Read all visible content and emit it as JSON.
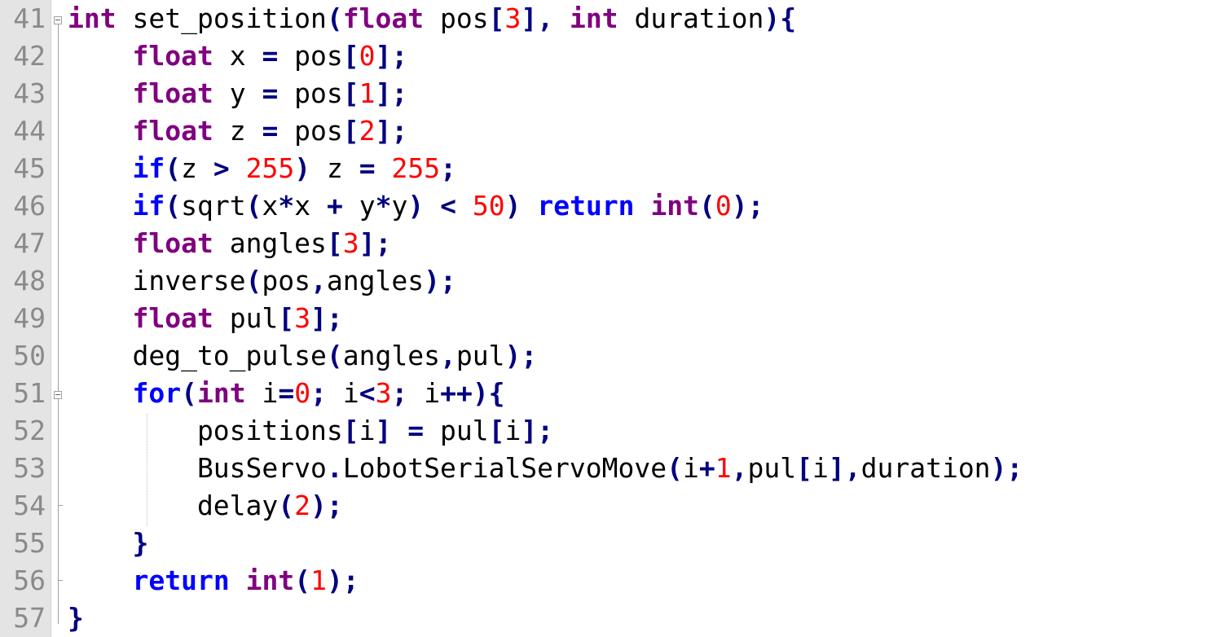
{
  "editor": {
    "lines": [
      {
        "number": "41",
        "tokens": [
          {
            "t": "int",
            "c": "kw-purple"
          },
          {
            "t": " set_position",
            "c": "ident"
          },
          {
            "t": "(",
            "c": "op"
          },
          {
            "t": "float",
            "c": "kw-purple"
          },
          {
            "t": " pos",
            "c": "ident"
          },
          {
            "t": "[",
            "c": "op"
          },
          {
            "t": "3",
            "c": "num"
          },
          {
            "t": "],",
            "c": "op"
          },
          {
            "t": " ",
            "c": "ident"
          },
          {
            "t": "int",
            "c": "kw-purple"
          },
          {
            "t": " duration",
            "c": "ident"
          },
          {
            "t": "){",
            "c": "op"
          }
        ]
      },
      {
        "number": "42",
        "tokens": [
          {
            "t": "    ",
            "c": "ident"
          },
          {
            "t": "float",
            "c": "kw-purple"
          },
          {
            "t": " x ",
            "c": "ident"
          },
          {
            "t": "=",
            "c": "op"
          },
          {
            "t": " pos",
            "c": "ident"
          },
          {
            "t": "[",
            "c": "op"
          },
          {
            "t": "0",
            "c": "num"
          },
          {
            "t": "];",
            "c": "op"
          }
        ]
      },
      {
        "number": "43",
        "tokens": [
          {
            "t": "    ",
            "c": "ident"
          },
          {
            "t": "float",
            "c": "kw-purple"
          },
          {
            "t": " y ",
            "c": "ident"
          },
          {
            "t": "=",
            "c": "op"
          },
          {
            "t": " pos",
            "c": "ident"
          },
          {
            "t": "[",
            "c": "op"
          },
          {
            "t": "1",
            "c": "num"
          },
          {
            "t": "];",
            "c": "op"
          }
        ]
      },
      {
        "number": "44",
        "tokens": [
          {
            "t": "    ",
            "c": "ident"
          },
          {
            "t": "float",
            "c": "kw-purple"
          },
          {
            "t": " z ",
            "c": "ident"
          },
          {
            "t": "=",
            "c": "op"
          },
          {
            "t": " pos",
            "c": "ident"
          },
          {
            "t": "[",
            "c": "op"
          },
          {
            "t": "2",
            "c": "num"
          },
          {
            "t": "];",
            "c": "op"
          }
        ]
      },
      {
        "number": "45",
        "tokens": [
          {
            "t": "    ",
            "c": "ident"
          },
          {
            "t": "if",
            "c": "kw-blue"
          },
          {
            "t": "(",
            "c": "op"
          },
          {
            "t": "z ",
            "c": "ident"
          },
          {
            "t": ">",
            "c": "op"
          },
          {
            "t": " ",
            "c": "ident"
          },
          {
            "t": "255",
            "c": "num"
          },
          {
            "t": ")",
            "c": "op"
          },
          {
            "t": " z ",
            "c": "ident"
          },
          {
            "t": "=",
            "c": "op"
          },
          {
            "t": " ",
            "c": "ident"
          },
          {
            "t": "255",
            "c": "num"
          },
          {
            "t": ";",
            "c": "op"
          }
        ]
      },
      {
        "number": "46",
        "tokens": [
          {
            "t": "    ",
            "c": "ident"
          },
          {
            "t": "if",
            "c": "kw-blue"
          },
          {
            "t": "(",
            "c": "op"
          },
          {
            "t": "sqrt",
            "c": "ident"
          },
          {
            "t": "(",
            "c": "op"
          },
          {
            "t": "x",
            "c": "ident"
          },
          {
            "t": "*",
            "c": "op"
          },
          {
            "t": "x ",
            "c": "ident"
          },
          {
            "t": "+",
            "c": "op"
          },
          {
            "t": " y",
            "c": "ident"
          },
          {
            "t": "*",
            "c": "op"
          },
          {
            "t": "y",
            "c": "ident"
          },
          {
            "t": ")",
            "c": "op"
          },
          {
            "t": " ",
            "c": "ident"
          },
          {
            "t": "<",
            "c": "op"
          },
          {
            "t": " ",
            "c": "ident"
          },
          {
            "t": "50",
            "c": "num"
          },
          {
            "t": ")",
            "c": "op"
          },
          {
            "t": " ",
            "c": "ident"
          },
          {
            "t": "return",
            "c": "kw-blue"
          },
          {
            "t": " ",
            "c": "ident"
          },
          {
            "t": "int",
            "c": "kw-purple"
          },
          {
            "t": "(",
            "c": "op"
          },
          {
            "t": "0",
            "c": "num"
          },
          {
            "t": ");",
            "c": "op"
          }
        ]
      },
      {
        "number": "47",
        "tokens": [
          {
            "t": "    ",
            "c": "ident"
          },
          {
            "t": "float",
            "c": "kw-purple"
          },
          {
            "t": " angles",
            "c": "ident"
          },
          {
            "t": "[",
            "c": "op"
          },
          {
            "t": "3",
            "c": "num"
          },
          {
            "t": "];",
            "c": "op"
          }
        ]
      },
      {
        "number": "48",
        "tokens": [
          {
            "t": "    inverse",
            "c": "ident"
          },
          {
            "t": "(",
            "c": "op"
          },
          {
            "t": "pos",
            "c": "ident"
          },
          {
            "t": ",",
            "c": "op"
          },
          {
            "t": "angles",
            "c": "ident"
          },
          {
            "t": ");",
            "c": "op"
          }
        ]
      },
      {
        "number": "49",
        "tokens": [
          {
            "t": "    ",
            "c": "ident"
          },
          {
            "t": "float",
            "c": "kw-purple"
          },
          {
            "t": " pul",
            "c": "ident"
          },
          {
            "t": "[",
            "c": "op"
          },
          {
            "t": "3",
            "c": "num"
          },
          {
            "t": "];",
            "c": "op"
          }
        ]
      },
      {
        "number": "50",
        "tokens": [
          {
            "t": "    deg_to_pulse",
            "c": "ident"
          },
          {
            "t": "(",
            "c": "op"
          },
          {
            "t": "angles",
            "c": "ident"
          },
          {
            "t": ",",
            "c": "op"
          },
          {
            "t": "pul",
            "c": "ident"
          },
          {
            "t": ");",
            "c": "op"
          }
        ]
      },
      {
        "number": "51",
        "tokens": [
          {
            "t": "    ",
            "c": "ident"
          },
          {
            "t": "for",
            "c": "kw-blue"
          },
          {
            "t": "(",
            "c": "op"
          },
          {
            "t": "int",
            "c": "kw-purple"
          },
          {
            "t": " i",
            "c": "ident"
          },
          {
            "t": "=",
            "c": "op"
          },
          {
            "t": "0",
            "c": "num"
          },
          {
            "t": ";",
            "c": "op"
          },
          {
            "t": " i",
            "c": "ident"
          },
          {
            "t": "<",
            "c": "op"
          },
          {
            "t": "3",
            "c": "num"
          },
          {
            "t": ";",
            "c": "op"
          },
          {
            "t": " i",
            "c": "ident"
          },
          {
            "t": "++){",
            "c": "op"
          }
        ]
      },
      {
        "number": "52",
        "tokens": [
          {
            "t": "        positions",
            "c": "ident"
          },
          {
            "t": "[",
            "c": "op"
          },
          {
            "t": "i",
            "c": "ident"
          },
          {
            "t": "]",
            "c": "op"
          },
          {
            "t": " ",
            "c": "ident"
          },
          {
            "t": "=",
            "c": "op"
          },
          {
            "t": " pul",
            "c": "ident"
          },
          {
            "t": "[",
            "c": "op"
          },
          {
            "t": "i",
            "c": "ident"
          },
          {
            "t": "];",
            "c": "op"
          }
        ]
      },
      {
        "number": "53",
        "tokens": [
          {
            "t": "        BusServo",
            "c": "ident"
          },
          {
            "t": ".",
            "c": "op"
          },
          {
            "t": "LobotSerialServoMove",
            "c": "ident"
          },
          {
            "t": "(",
            "c": "op"
          },
          {
            "t": "i",
            "c": "ident"
          },
          {
            "t": "+",
            "c": "op"
          },
          {
            "t": "1",
            "c": "num"
          },
          {
            "t": ",",
            "c": "op"
          },
          {
            "t": "pul",
            "c": "ident"
          },
          {
            "t": "[",
            "c": "op"
          },
          {
            "t": "i",
            "c": "ident"
          },
          {
            "t": "],",
            "c": "op"
          },
          {
            "t": "duration",
            "c": "ident"
          },
          {
            "t": ");",
            "c": "op"
          }
        ]
      },
      {
        "number": "54",
        "tokens": [
          {
            "t": "        delay",
            "c": "ident"
          },
          {
            "t": "(",
            "c": "op"
          },
          {
            "t": "2",
            "c": "num"
          },
          {
            "t": ");",
            "c": "op"
          }
        ]
      },
      {
        "number": "55",
        "tokens": [
          {
            "t": "    ",
            "c": "ident"
          },
          {
            "t": "}",
            "c": "op"
          }
        ]
      },
      {
        "number": "56",
        "tokens": [
          {
            "t": "    ",
            "c": "ident"
          },
          {
            "t": "return",
            "c": "kw-blue"
          },
          {
            "t": " ",
            "c": "ident"
          },
          {
            "t": "int",
            "c": "kw-purple"
          },
          {
            "t": "(",
            "c": "op"
          },
          {
            "t": "1",
            "c": "num"
          },
          {
            "t": ");",
            "c": "op"
          }
        ]
      },
      {
        "number": "57",
        "tokens": [
          {
            "t": "}",
            "c": "op"
          }
        ]
      }
    ]
  }
}
